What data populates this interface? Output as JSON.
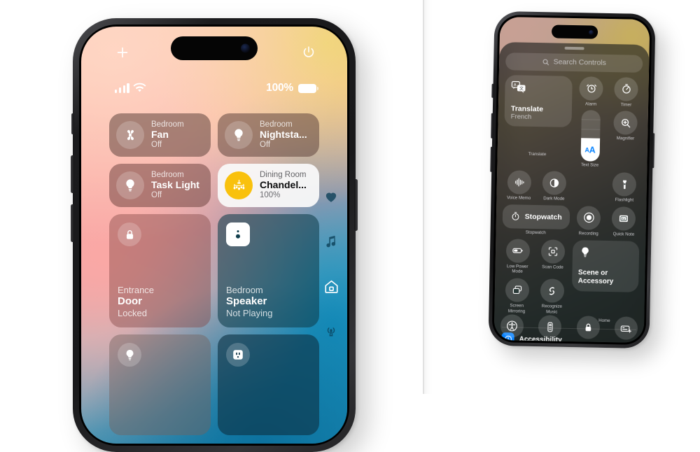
{
  "left_phone": {
    "status_bar": {
      "battery_percent": "100%",
      "signal_icon": "cellular-signal-icon",
      "wifi_icon": "wifi-icon",
      "battery_icon": "battery-full-icon"
    },
    "top_controls": {
      "add_label": "add-icon",
      "power_label": "power-icon"
    },
    "tiles": [
      {
        "room": "Bedroom",
        "name": "Fan",
        "state": "Off",
        "icon": "fan-icon",
        "size": "small",
        "style": "dim",
        "on": false
      },
      {
        "room": "Bedroom",
        "name": "Nightsta...",
        "state": "Off",
        "icon": "bulb-icon",
        "size": "small",
        "style": "dim",
        "on": false
      },
      {
        "room": "Bedroom",
        "name": "Task Light",
        "state": "Off",
        "icon": "bulb-icon",
        "size": "small",
        "style": "dim2",
        "on": false
      },
      {
        "room": "Dining Room",
        "name": "Chandel...",
        "state": "100%",
        "icon": "chandelier-icon",
        "size": "small",
        "style": "on",
        "on": true
      },
      {
        "room": "Entrance",
        "name": "Door",
        "state": "Locked",
        "icon": "lock-icon",
        "size": "big",
        "style": "door",
        "on": false
      },
      {
        "room": "Bedroom",
        "name": "Speaker",
        "state": "Not Playing",
        "icon": "speaker-icon",
        "size": "big",
        "style": "spk",
        "on": false
      }
    ],
    "partial_tiles": [
      {
        "icon": "bulb-icon",
        "style": "bulb2"
      },
      {
        "icon": "outlet-icon",
        "style": "plug"
      }
    ],
    "side_rail": [
      {
        "icon": "heart-icon",
        "name": "favorites",
        "active": false
      },
      {
        "icon": "music-icon",
        "name": "media",
        "active": false
      },
      {
        "icon": "home-icon",
        "name": "home",
        "active": true
      },
      {
        "icon": "sensor-icon",
        "name": "sensors",
        "active": false
      }
    ]
  },
  "right_phone": {
    "search": {
      "placeholder": "Search Controls",
      "icon": "search-icon"
    },
    "translate_widget": {
      "title": "Translate",
      "subtitle": "French",
      "caption": "Translate",
      "icon": "translate-icon"
    },
    "scene_widget": {
      "title": "Scene or\nAccessory",
      "caption": "Home",
      "icon": "bulb-icon"
    },
    "stopwatch_widget": {
      "label": "Stopwatch",
      "caption": "Stopwatch",
      "icon": "stopwatch-icon"
    },
    "text_size": {
      "caption": "Text Size",
      "small_glyph": "A",
      "big_glyph": "A",
      "fill_percent": 45
    },
    "controls": [
      {
        "caption": "Alarm",
        "icon": "alarm-icon"
      },
      {
        "caption": "Timer",
        "icon": "timer-icon"
      },
      {
        "caption": "Magnifier",
        "icon": "magnifier-icon"
      },
      {
        "caption": "Voice Memo",
        "icon": "waveform-icon"
      },
      {
        "caption": "Dark Mode",
        "icon": "dark-mode-icon"
      },
      {
        "caption": "Flashlight",
        "icon": "flashlight-icon"
      },
      {
        "caption": "Recording",
        "icon": "record-icon"
      },
      {
        "caption": "Quick Note",
        "icon": "quick-note-icon"
      },
      {
        "caption": "Low Power\nMode",
        "icon": "low-power-icon"
      },
      {
        "caption": "Scan Code",
        "icon": "scan-code-icon"
      },
      {
        "caption": "Screen\nMirroring",
        "icon": "screen-mirroring-icon"
      },
      {
        "caption": "Recognize\nMusic",
        "icon": "shazam-icon"
      }
    ],
    "accessibility_row": {
      "label": "Accessibility",
      "icon": "accessibility-badge-icon"
    },
    "dock": [
      {
        "name": "accessibility-shortcut",
        "icon": "accessibility-icon"
      },
      {
        "name": "remote",
        "icon": "remote-icon"
      },
      {
        "name": "lock-rotation",
        "icon": "lock-icon"
      },
      {
        "name": "text-replacement",
        "icon": "keyboard-add-icon"
      }
    ]
  },
  "colors": {
    "accent_blue": "#0a84ff",
    "chandelier_yellow": "#f9c10d",
    "sheet": "#181c1c"
  }
}
